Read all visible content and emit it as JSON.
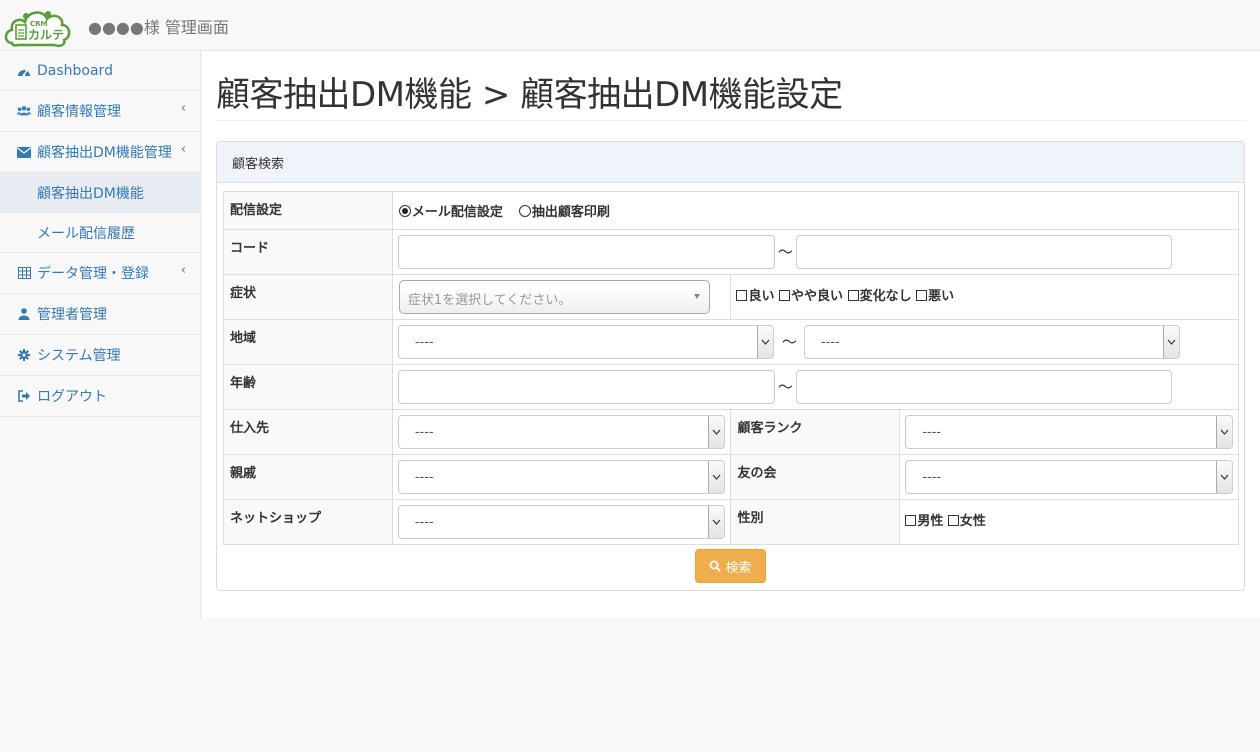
{
  "header": {
    "logo_text_top": "CRM",
    "logo_text_main": "カルテ",
    "title": "●●●●様 管理画面"
  },
  "sidebar": {
    "items": [
      {
        "label": "Dashboard",
        "icon": "dashboard-icon"
      },
      {
        "label": "顧客情報管理",
        "icon": "users-icon",
        "chevron": "‹"
      },
      {
        "label": "顧客抽出DM機能管理",
        "icon": "envelope-icon",
        "chevron": "‹"
      },
      {
        "label": "顧客抽出DM機能",
        "sub": true,
        "active": true
      },
      {
        "label": "メール配信履歴",
        "sub": true
      },
      {
        "label": "データ管理・登録",
        "icon": "table-icon",
        "chevron": "‹"
      },
      {
        "label": "管理者管理",
        "icon": "user-icon"
      },
      {
        "label": "システム管理",
        "icon": "gear-icon"
      },
      {
        "label": "ログアウト",
        "icon": "logout-icon"
      }
    ]
  },
  "main": {
    "title": "顧客抽出DM機能 > 顧客抽出DM機能設定",
    "panel_heading": "顧客検索",
    "form": {
      "delivery": {
        "label": "配信設定",
        "options": [
          "メール配信設定",
          "抽出顧客印刷"
        ],
        "selected": "メール配信設定"
      },
      "code": {
        "label": "コード",
        "from": "",
        "to": "",
        "separator": "～"
      },
      "symptom": {
        "label": "症状",
        "placeholder": "症状1を選択してください。",
        "checks": [
          "良い",
          "やや良い",
          "変化なし",
          "悪い"
        ]
      },
      "region": {
        "label": "地域",
        "from": "----",
        "to": "----",
        "separator": "～"
      },
      "age": {
        "label": "年齢",
        "from": "",
        "to": "",
        "separator": "～"
      },
      "supplier": {
        "label": "仕入先",
        "value": "----"
      },
      "customer_rank": {
        "label": "顧客ランク",
        "value": "----"
      },
      "relatives": {
        "label": "親戚",
        "value": "----"
      },
      "friends_club": {
        "label": "友の会",
        "value": "----"
      },
      "net_shop": {
        "label": "ネットショップ",
        "value": "----"
      },
      "gender": {
        "label": "性別",
        "checks": [
          "男性",
          "女性"
        ]
      }
    },
    "search_button": "検索"
  },
  "colors": {
    "link": "#337ab7",
    "warning_button": "#f0ad4e",
    "panel_heading_bg": "#f0f3fa"
  }
}
